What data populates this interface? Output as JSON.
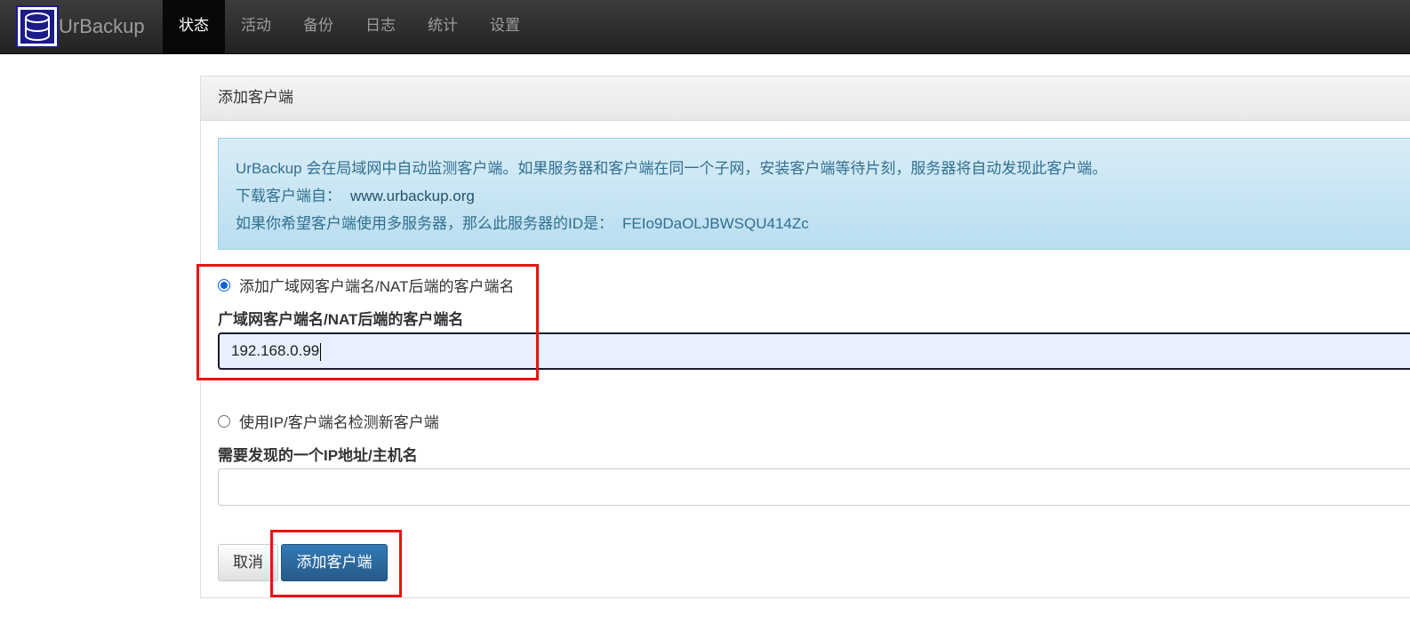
{
  "app": {
    "brand": "UrBackup",
    "logo_icon": "database-icon",
    "colors": {
      "navbar": "#222222",
      "accent": "#337ab7",
      "alert_text": "#31708f",
      "annotation": "#ee1111"
    }
  },
  "nav": {
    "items": [
      {
        "label": "状态",
        "active": true
      },
      {
        "label": "活动",
        "active": false
      },
      {
        "label": "备份",
        "active": false
      },
      {
        "label": "日志",
        "active": false
      },
      {
        "label": "统计",
        "active": false
      },
      {
        "label": "设置",
        "active": false
      }
    ]
  },
  "panel": {
    "title": "添加客户端",
    "alert": {
      "line1": "UrBackup 会在局域网中自动监测客户端。如果服务器和客户端在同一个子网，安装客户端等待片刻，服务器将自动发现此客户端。",
      "line2_prefix": "下载客户端自：",
      "line2_link": "www.urbackup.org",
      "line3_prefix": "如果你希望客户端使用多服务器，那么此服务器的ID是：",
      "line3_value": "FEIo9DaOLJBWSQU414Zc"
    },
    "option_internet": {
      "radio_label": "添加广域网客户端名/NAT后端的客户端名",
      "checked": true,
      "field_label": "广域网客户端名/NAT后端的客户端名",
      "value": "192.168.0.99"
    },
    "option_ip": {
      "radio_label": "使用IP/客户端名检测新客户端",
      "checked": false,
      "field_label": "需要发现的一个IP地址/主机名",
      "value": ""
    },
    "buttons": {
      "cancel": "取消",
      "add": "添加客户端"
    }
  }
}
